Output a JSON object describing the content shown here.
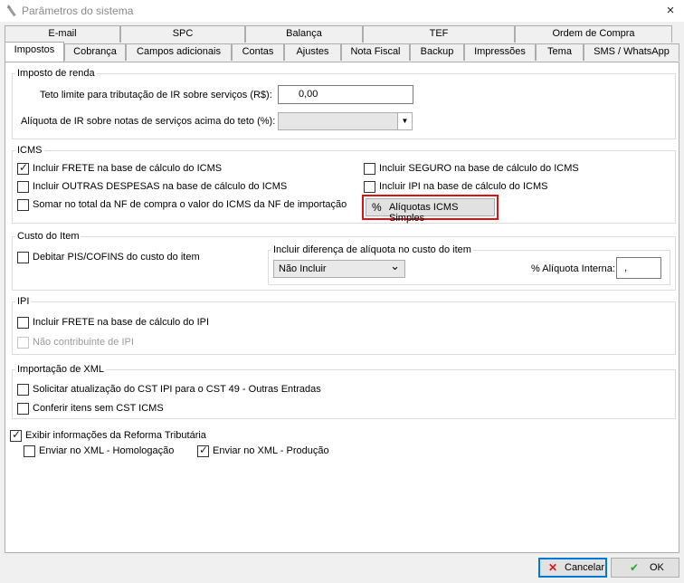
{
  "window": {
    "title": "Parâmetros do sistema",
    "close_glyph": "×"
  },
  "tabs_row1": [
    "E-mail",
    "SPC",
    "Balança",
    "TEF",
    "Ordem de Compra"
  ],
  "tabs_row2": [
    "Impostos",
    "Cobrança",
    "Campos adicionais",
    "Contas",
    "Ajustes",
    "Nota Fiscal",
    "Backup",
    "Impressões",
    "Tema",
    "SMS / WhatsApp"
  ],
  "ir": {
    "title": "Imposto de renda",
    "teto_label": "Teto limite para tributação de IR sobre serviços (R$):",
    "teto_value": "0,00",
    "aliquota_label": "Alíquota de IR sobre notas de serviços acima do teto (%):"
  },
  "icms": {
    "title": "ICMS",
    "frete": "Incluir FRETE na base de cálculo do ICMS",
    "despesas": "Incluir OUTRAS DESPESAS na base de cálculo do ICMS",
    "somar": "Somar no total da NF de compra o valor do ICMS da NF de importação",
    "seguro": "Incluir SEGURO na base de cálculo do ICMS",
    "ipi": "Incluir IPI na base de cálculo do ICMS",
    "button": "Alíquotas ICMS Simples",
    "button_glyph": "%"
  },
  "custo": {
    "title": "Custo do Item",
    "debitar": "Debitar PIS/COFINS do custo do item",
    "diferenca_title": "Incluir diferença de alíquota no custo do item",
    "combo_value": "Não Incluir",
    "combo_arrow": "⌄",
    "aliquota_interna_label": "% Alíquota Interna:",
    "aliquota_interna_value": ","
  },
  "ipi": {
    "title": "IPI",
    "frete": "Incluir FRETE na base de cálculo do IPI",
    "nao_contribuinte": "Não contribuinte de IPI"
  },
  "xml": {
    "title": "Importação de XML",
    "solicitar": "Solicitar atualização do CST IPI para o CST 49 - Outras Entradas",
    "conferir": "Conferir itens sem CST ICMS"
  },
  "reforma": {
    "exibir": "Exibir informações da Reforma Tributária",
    "homologacao": "Enviar no XML - Homologação",
    "producao": "Enviar no XML - Produção"
  },
  "footer": {
    "cancel": "Cancelar",
    "cancel_glyph": "✕",
    "ok": "OK",
    "ok_glyph": "✔",
    "cancel_color": "#d01818",
    "ok_color": "#22aa22"
  },
  "check_glyph": "✓",
  "highlight_color": "#e01010",
  "focus_color": "#0078d7"
}
